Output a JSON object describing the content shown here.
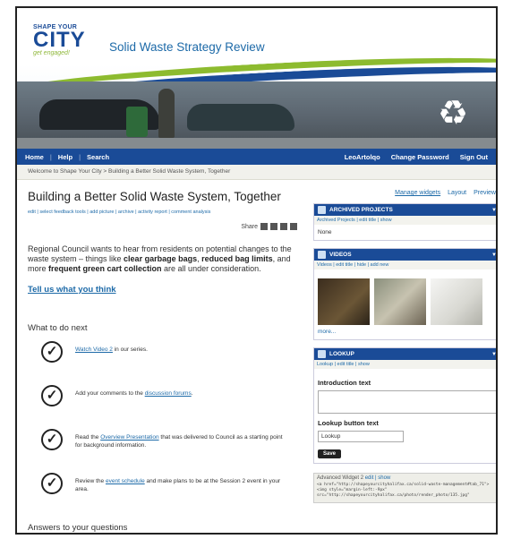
{
  "header": {
    "logo_line1": "SHAPE YOUR",
    "logo_line2": "CITY",
    "logo_line3": "get engaged!",
    "site_title": "Solid Waste Strategy Review"
  },
  "nav": {
    "items": [
      "Home",
      "Help",
      "Search"
    ],
    "user": "LeoArtolqo",
    "change_password": "Change Password",
    "sign_out": "Sign Out"
  },
  "breadcrumb": "Welcome to Shape Your City  >  Building a Better Solid Waste System, Together",
  "main": {
    "title": "Building a Better Solid Waste System, Together",
    "edit_links": "edit | select feedback tools | add picture | archive | activity report | comment analysis",
    "share_label": "Share",
    "intro_part1": "Regional Council wants to hear from residents on potential changes to the waste system – things like ",
    "intro_bold1": "clear garbage bags",
    "intro_sep1": ", ",
    "intro_bold2": "reduced bag limits",
    "intro_part2": ", and more ",
    "intro_bold3": "frequent green cart collection",
    "intro_part3": " are all under consideration.",
    "cta": "Tell us what you think",
    "what_next": "What to do next",
    "steps": [
      {
        "pre": "",
        "link": "Watch Video 2",
        "post": " in our series."
      },
      {
        "pre": "Add your comments to the ",
        "link": "discussion forums",
        "post": "."
      },
      {
        "pre": "Read the ",
        "link": "Overview Presentation",
        "post": " that was delivered to Council as a starting point for background information."
      },
      {
        "pre": "Review the ",
        "link": "event schedule",
        "post": " and make plans to be at the Session 2 event in your area."
      }
    ],
    "answers": "Answers to your questions"
  },
  "sidebar": {
    "manage": "Manage widgets",
    "layout": "Layout",
    "preview": "Preview",
    "archived": {
      "title": "ARCHIVED PROJECTS",
      "links": "Archived Projects | edit title | show",
      "body": "None"
    },
    "videos": {
      "title": "VIDEOS",
      "links": "Videos | edit title | hide | add new",
      "more": "more..."
    },
    "lookup": {
      "title": "LOOKUP",
      "links": "Lookup | edit title | show",
      "intro_label": "Introduction text",
      "button_label": "Lookup button text",
      "button_value": "Lookup",
      "save": "Save"
    },
    "advanced": {
      "title": "Advanced Widget 2",
      "links": "edit | show",
      "code": "<a href=\"http://shapeyourcityhalifax.ca/solid-waste-management#tab_71\"><img style=\"margin-left:-9px\" src=\"http://shapeyourcityhalifax.ca/photo/render_photo/135.jpg\""
    }
  },
  "colors": {
    "brand_blue": "#1a4b97",
    "brand_green": "#8dbb2f",
    "link": "#1d6aa8"
  }
}
